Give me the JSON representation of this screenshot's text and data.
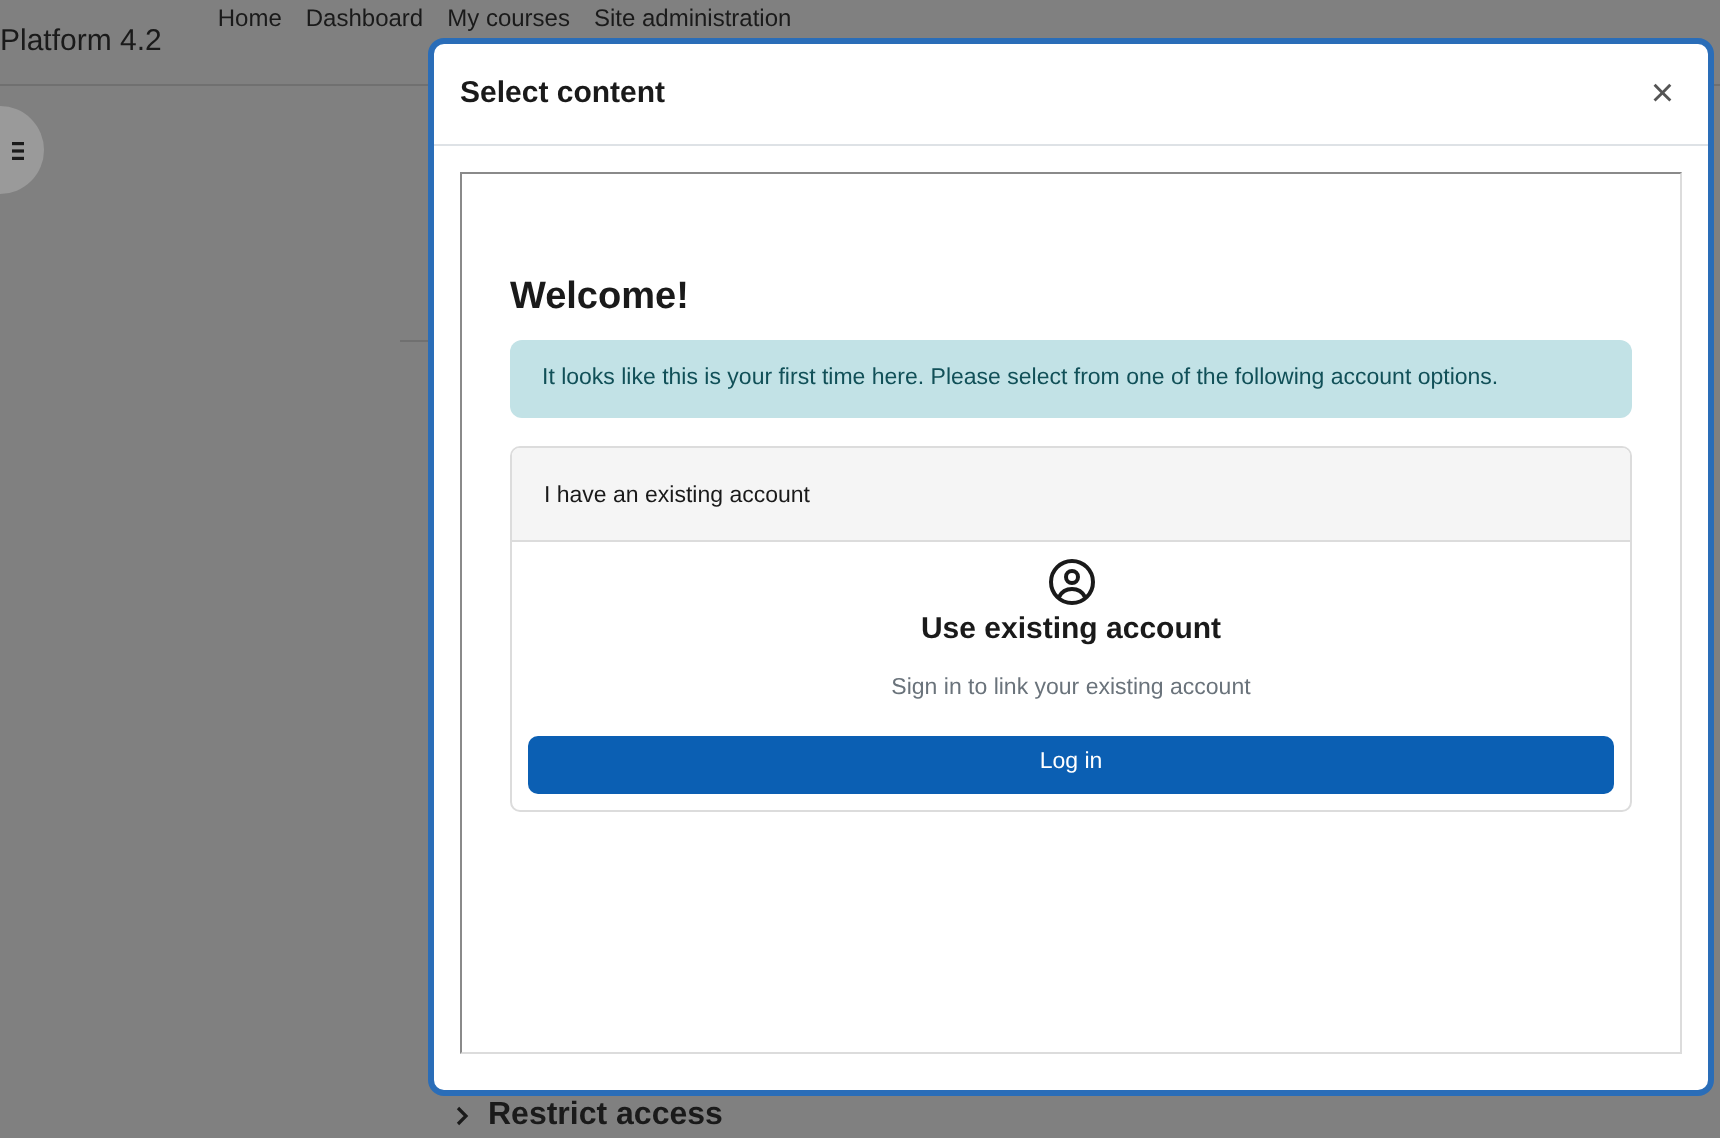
{
  "site_name": "Platform 4.2",
  "nav": [
    {
      "label": "Home"
    },
    {
      "label": "Dashboard"
    },
    {
      "label": "My courses"
    },
    {
      "label": "Site administration"
    }
  ],
  "section_heading": "Restrict access",
  "modal": {
    "title": "Select content",
    "close": "×",
    "content": {
      "heading": "Welcome!",
      "alert": "It looks like this is your first time here. Please select from one of the following account options.",
      "card": {
        "header": "I have an existing account",
        "title": "Use existing account",
        "subtitle": "Sign in to link your existing account",
        "button": "Log in"
      }
    }
  }
}
